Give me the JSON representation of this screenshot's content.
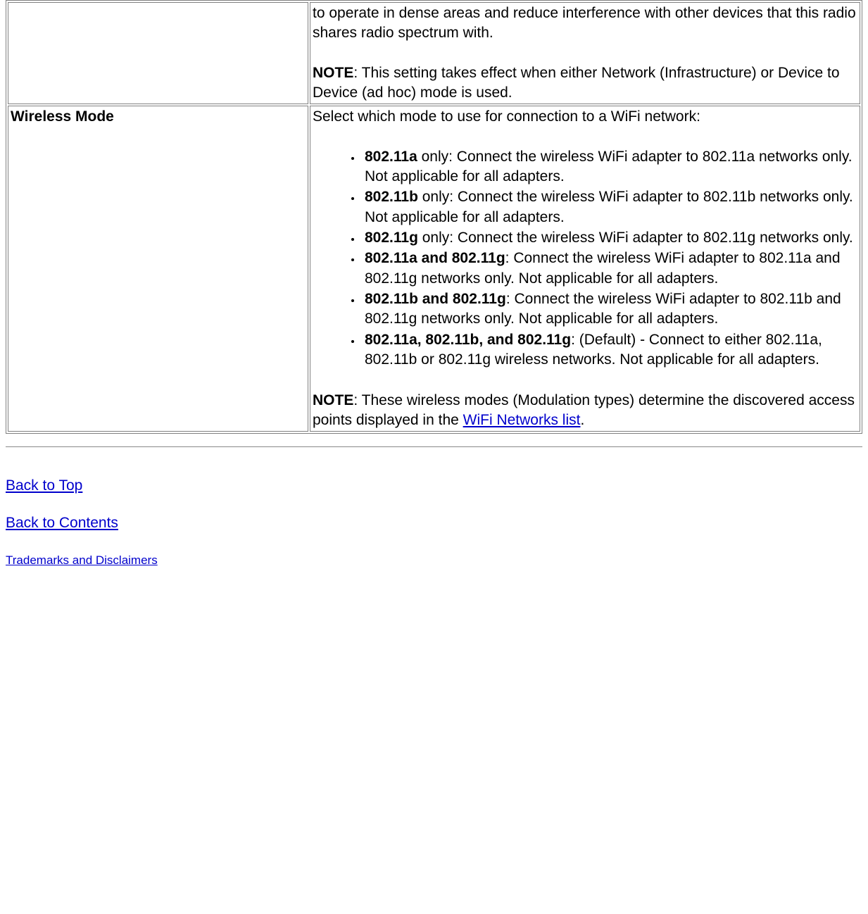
{
  "table": {
    "row1": {
      "desc_line1": "to operate in dense areas and reduce interference with other devices that this radio shares radio spectrum with.",
      "note_label": "NOTE",
      "note_text": ": This setting takes effect when either Network (Infrastructure) or Device to Device (ad hoc) mode is used."
    },
    "row2": {
      "label": "Wireless Mode",
      "intro": "Select which mode to use for connection to a WiFi network:",
      "items": [
        {
          "bold": "802.11a",
          "rest": " only: Connect the wireless WiFi adapter to 802.11a networks only. Not applicable for all adapters."
        },
        {
          "bold": "802.11b",
          "rest": " only: Connect the wireless WiFi adapter to 802.11b networks only. Not applicable for all adapters."
        },
        {
          "bold": "802.11g",
          "rest": " only: Connect the wireless WiFi adapter to 802.11g networks only."
        },
        {
          "bold": "802.11a and 802.11g",
          "rest": ": Connect the wireless WiFi adapter to 802.11a and 802.11g networks only. Not applicable for all adapters."
        },
        {
          "bold": "802.11b and 802.11g",
          "rest": ": Connect the wireless WiFi adapter to 802.11b and 802.11g networks only. Not applicable for all adapters."
        },
        {
          "bold": "802.11a, 802.11b, and 802.11g",
          "rest": ": (Default) - Connect to either 802.11a, 802.11b or 802.11g wireless networks. Not applicable for all adapters."
        }
      ],
      "note_label": "NOTE",
      "note_text_before": ": These wireless modes (Modulation types) determine the discovered access points displayed in the ",
      "note_link": "WiFi Networks list",
      "note_text_after": "."
    }
  },
  "footer": {
    "back_top": "Back to Top",
    "back_contents": "Back to Contents",
    "trademarks": "Trademarks and Disclaimers"
  }
}
